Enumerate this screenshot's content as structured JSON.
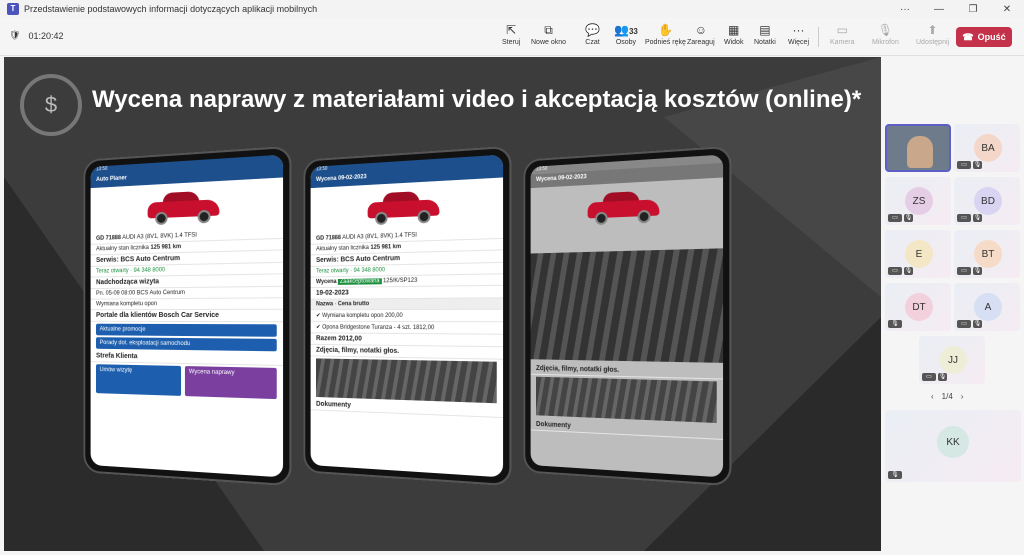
{
  "window": {
    "title": "Przedstawienie podstawowych informacji dotyczących aplikacji mobilnych"
  },
  "toolbar": {
    "timer": "01:20:42",
    "buttons": [
      {
        "label": "Steruj",
        "icon": "cast-icon"
      },
      {
        "label": "Nowe okno",
        "icon": "new-window-icon"
      },
      {
        "label": "Czat",
        "icon": "chat-icon"
      },
      {
        "label": "Osoby",
        "icon": "people-icon",
        "count": "33"
      },
      {
        "label": "Podnieś rękę",
        "icon": "raise-hand-icon"
      },
      {
        "label": "Zareaguj",
        "icon": "react-icon"
      },
      {
        "label": "Widok",
        "icon": "view-icon"
      },
      {
        "label": "Notatki",
        "icon": "notes-icon"
      },
      {
        "label": "Więcej",
        "icon": "more-icon"
      },
      {
        "label": "Kamera",
        "icon": "camera-icon",
        "disabled": true
      },
      {
        "label": "Mikrofon",
        "icon": "mic-icon",
        "disabled": true
      },
      {
        "label": "Udostępnij",
        "icon": "share-icon",
        "disabled": true
      }
    ],
    "leave_label": "Opuść"
  },
  "slide": {
    "title": "Wycena naprawy z materiałami video i akceptacją kosztów (online)*",
    "phone1": {
      "appbar": "Auto Planer",
      "plate": "GD 71888",
      "car": "AUDI A3 (8V1, 8VK) 1.4 TFSI",
      "mileage_label": "Aktualny stan licznika",
      "mileage": "125 981 km",
      "service": "Serwis: BCS Auto Centrum",
      "open": "Teraz otwarty",
      "phone": "94 348 8000",
      "next_visit": "Nadchodząca wizyta",
      "visit": "Pn. 05-09  08:00  BCS Auto Centrum",
      "visit_item": "Wymiana kompletu opon",
      "portal": "Portale dla klientów Bosch Car Service",
      "promo": "Aktualne promocje",
      "tips": "Porady dot. eksploatacji samochodu",
      "zone": "Strefa Klienta",
      "book": "Umów wizytę",
      "quote": "Wycena naprawy"
    },
    "phone2": {
      "appbar": "Wycena 09-02-2023",
      "plate": "GD 71888",
      "car": "AUDI A3 (8V1, 8VK) 1.4 TFSI",
      "mileage_label": "Aktualny stan licznika",
      "mileage": "125 981 km",
      "service": "Serwis: BCS Auto Centrum",
      "open": "Teraz otwarty",
      "phone": "94 348 8000",
      "quote_label": "Wycena",
      "accepted": "Zaakceptowana",
      "number": "125/K/SP123",
      "date": "19-02-2023",
      "col_name": "Nazwa",
      "col_price": "Cena brutto",
      "items": [
        {
          "name": "Wymiana kompletu opon",
          "price": "200,00"
        },
        {
          "name": "Opona Bridgestone Turanza - 4 szt.",
          "price": "1812,00"
        }
      ],
      "total_label": "Razem",
      "total": "2012,00",
      "media": "Zdjęcia, filmy, notatki głos.",
      "docs": "Dokumenty"
    },
    "phone3": {
      "appbar": "Wycena 09-02-2023",
      "media": "Zdjęcia, filmy, notatki głos.",
      "docs": "Dokumenty"
    }
  },
  "participants": [
    {
      "initials": "",
      "video": true
    },
    {
      "initials": "BA"
    },
    {
      "initials": "ZS"
    },
    {
      "initials": "BD"
    },
    {
      "initials": "E"
    },
    {
      "initials": "BT"
    },
    {
      "initials": "DT"
    },
    {
      "initials": "A"
    },
    {
      "initials": "JJ"
    }
  ],
  "pager": "1/4",
  "spotlight": {
    "initials": "KK"
  },
  "colors": {
    "leave": "#c4314b",
    "accent": "#5b5fc7",
    "app_blue": "#1d4f8c"
  }
}
